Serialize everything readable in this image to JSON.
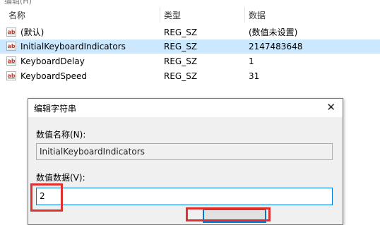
{
  "topbar": {
    "text": "编辑(H)"
  },
  "columns": {
    "name": "名称",
    "type": "类型",
    "data": "数据"
  },
  "rows": [
    {
      "name": "(默认)",
      "type": "REG_SZ",
      "data": "(数值未设置)",
      "selected": false
    },
    {
      "name": "InitialKeyboardIndicators",
      "type": "REG_SZ",
      "data": "2147483648",
      "selected": true
    },
    {
      "name": "KeyboardDelay",
      "type": "REG_SZ",
      "data": "1",
      "selected": false
    },
    {
      "name": "KeyboardSpeed",
      "type": "REG_SZ",
      "data": "31",
      "selected": false
    }
  ],
  "row_icon": {
    "icon": "string-value-icon",
    "text": "ab"
  },
  "dialog": {
    "title": "编辑字符串",
    "close_glyph": "✕",
    "name_label": "数值名称(N):",
    "name_value": "InitialKeyboardIndicators",
    "data_label": "数值数据(V):",
    "data_value": "2"
  },
  "colors": {
    "selection": "#cce8ff",
    "highlight": "#e03131",
    "focus": "#0078d7"
  }
}
